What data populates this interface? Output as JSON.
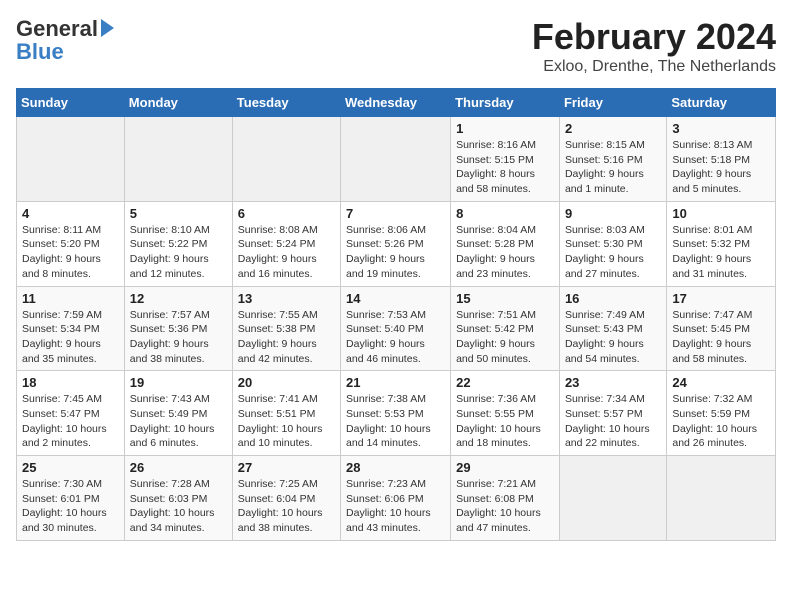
{
  "header": {
    "logo_general": "General",
    "logo_blue": "Blue",
    "title": "February 2024",
    "subtitle": "Exloo, Drenthe, The Netherlands"
  },
  "days_of_week": [
    "Sunday",
    "Monday",
    "Tuesday",
    "Wednesday",
    "Thursday",
    "Friday",
    "Saturday"
  ],
  "weeks": [
    [
      {
        "day": "",
        "info": ""
      },
      {
        "day": "",
        "info": ""
      },
      {
        "day": "",
        "info": ""
      },
      {
        "day": "",
        "info": ""
      },
      {
        "day": "1",
        "info": "Sunrise: 8:16 AM\nSunset: 5:15 PM\nDaylight: 8 hours and 58 minutes."
      },
      {
        "day": "2",
        "info": "Sunrise: 8:15 AM\nSunset: 5:16 PM\nDaylight: 9 hours and 1 minute."
      },
      {
        "day": "3",
        "info": "Sunrise: 8:13 AM\nSunset: 5:18 PM\nDaylight: 9 hours and 5 minutes."
      }
    ],
    [
      {
        "day": "4",
        "info": "Sunrise: 8:11 AM\nSunset: 5:20 PM\nDaylight: 9 hours and 8 minutes."
      },
      {
        "day": "5",
        "info": "Sunrise: 8:10 AM\nSunset: 5:22 PM\nDaylight: 9 hours and 12 minutes."
      },
      {
        "day": "6",
        "info": "Sunrise: 8:08 AM\nSunset: 5:24 PM\nDaylight: 9 hours and 16 minutes."
      },
      {
        "day": "7",
        "info": "Sunrise: 8:06 AM\nSunset: 5:26 PM\nDaylight: 9 hours and 19 minutes."
      },
      {
        "day": "8",
        "info": "Sunrise: 8:04 AM\nSunset: 5:28 PM\nDaylight: 9 hours and 23 minutes."
      },
      {
        "day": "9",
        "info": "Sunrise: 8:03 AM\nSunset: 5:30 PM\nDaylight: 9 hours and 27 minutes."
      },
      {
        "day": "10",
        "info": "Sunrise: 8:01 AM\nSunset: 5:32 PM\nDaylight: 9 hours and 31 minutes."
      }
    ],
    [
      {
        "day": "11",
        "info": "Sunrise: 7:59 AM\nSunset: 5:34 PM\nDaylight: 9 hours and 35 minutes."
      },
      {
        "day": "12",
        "info": "Sunrise: 7:57 AM\nSunset: 5:36 PM\nDaylight: 9 hours and 38 minutes."
      },
      {
        "day": "13",
        "info": "Sunrise: 7:55 AM\nSunset: 5:38 PM\nDaylight: 9 hours and 42 minutes."
      },
      {
        "day": "14",
        "info": "Sunrise: 7:53 AM\nSunset: 5:40 PM\nDaylight: 9 hours and 46 minutes."
      },
      {
        "day": "15",
        "info": "Sunrise: 7:51 AM\nSunset: 5:42 PM\nDaylight: 9 hours and 50 minutes."
      },
      {
        "day": "16",
        "info": "Sunrise: 7:49 AM\nSunset: 5:43 PM\nDaylight: 9 hours and 54 minutes."
      },
      {
        "day": "17",
        "info": "Sunrise: 7:47 AM\nSunset: 5:45 PM\nDaylight: 9 hours and 58 minutes."
      }
    ],
    [
      {
        "day": "18",
        "info": "Sunrise: 7:45 AM\nSunset: 5:47 PM\nDaylight: 10 hours and 2 minutes."
      },
      {
        "day": "19",
        "info": "Sunrise: 7:43 AM\nSunset: 5:49 PM\nDaylight: 10 hours and 6 minutes."
      },
      {
        "day": "20",
        "info": "Sunrise: 7:41 AM\nSunset: 5:51 PM\nDaylight: 10 hours and 10 minutes."
      },
      {
        "day": "21",
        "info": "Sunrise: 7:38 AM\nSunset: 5:53 PM\nDaylight: 10 hours and 14 minutes."
      },
      {
        "day": "22",
        "info": "Sunrise: 7:36 AM\nSunset: 5:55 PM\nDaylight: 10 hours and 18 minutes."
      },
      {
        "day": "23",
        "info": "Sunrise: 7:34 AM\nSunset: 5:57 PM\nDaylight: 10 hours and 22 minutes."
      },
      {
        "day": "24",
        "info": "Sunrise: 7:32 AM\nSunset: 5:59 PM\nDaylight: 10 hours and 26 minutes."
      }
    ],
    [
      {
        "day": "25",
        "info": "Sunrise: 7:30 AM\nSunset: 6:01 PM\nDaylight: 10 hours and 30 minutes."
      },
      {
        "day": "26",
        "info": "Sunrise: 7:28 AM\nSunset: 6:03 PM\nDaylight: 10 hours and 34 minutes."
      },
      {
        "day": "27",
        "info": "Sunrise: 7:25 AM\nSunset: 6:04 PM\nDaylight: 10 hours and 38 minutes."
      },
      {
        "day": "28",
        "info": "Sunrise: 7:23 AM\nSunset: 6:06 PM\nDaylight: 10 hours and 43 minutes."
      },
      {
        "day": "29",
        "info": "Sunrise: 7:21 AM\nSunset: 6:08 PM\nDaylight: 10 hours and 47 minutes."
      },
      {
        "day": "",
        "info": ""
      },
      {
        "day": "",
        "info": ""
      }
    ]
  ]
}
